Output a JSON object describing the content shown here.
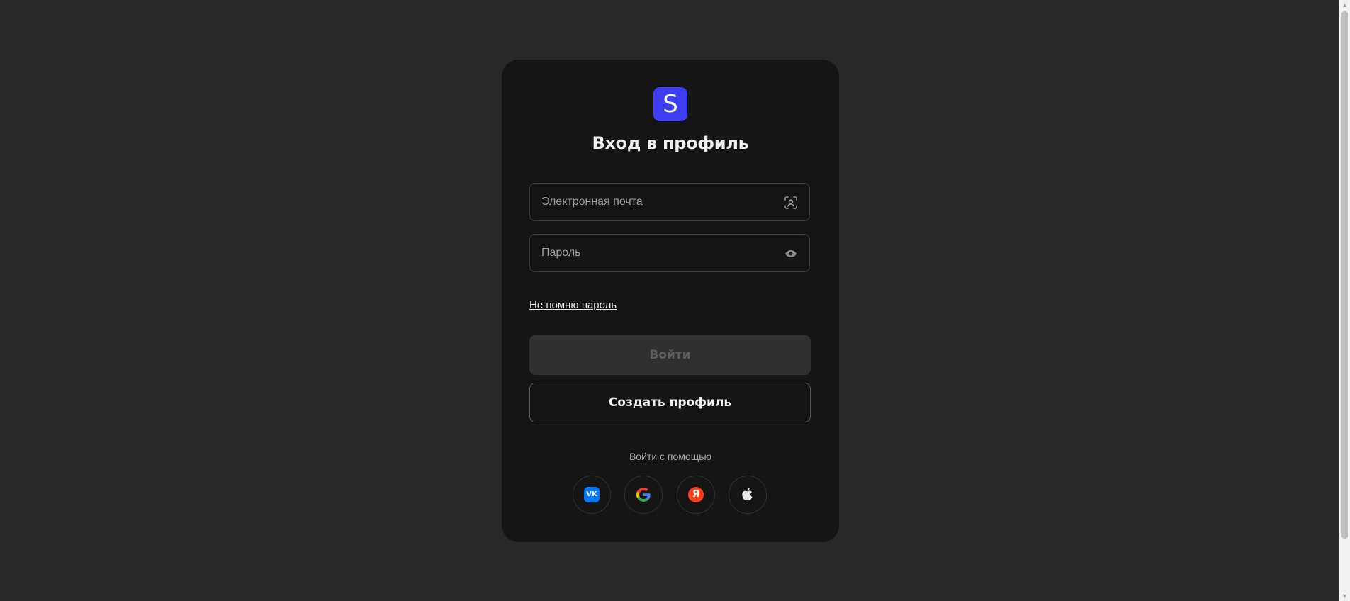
{
  "logo": {
    "letter": "S",
    "color": "#3d3df5"
  },
  "title": "Вход в профиль",
  "email": {
    "value": "",
    "placeholder": "Электронная почта",
    "icon": "face-scan-icon"
  },
  "password": {
    "value": "",
    "placeholder": "Пароль",
    "icon": "eye-icon"
  },
  "forgot_link": "Не помню пароль",
  "login_button": "Войти",
  "create_button": "Создать профиль",
  "social": {
    "label": "Войти с помощью",
    "providers": [
      {
        "name": "VK",
        "icon": "vk-icon",
        "glyph": "VK"
      },
      {
        "name": "Google",
        "icon": "google-icon"
      },
      {
        "name": "Yandex",
        "icon": "yandex-icon",
        "glyph": "Я"
      },
      {
        "name": "Apple",
        "icon": "apple-icon"
      }
    ]
  },
  "colors": {
    "background": "#282828",
    "card": "#151515",
    "accent": "#3d3df5"
  }
}
